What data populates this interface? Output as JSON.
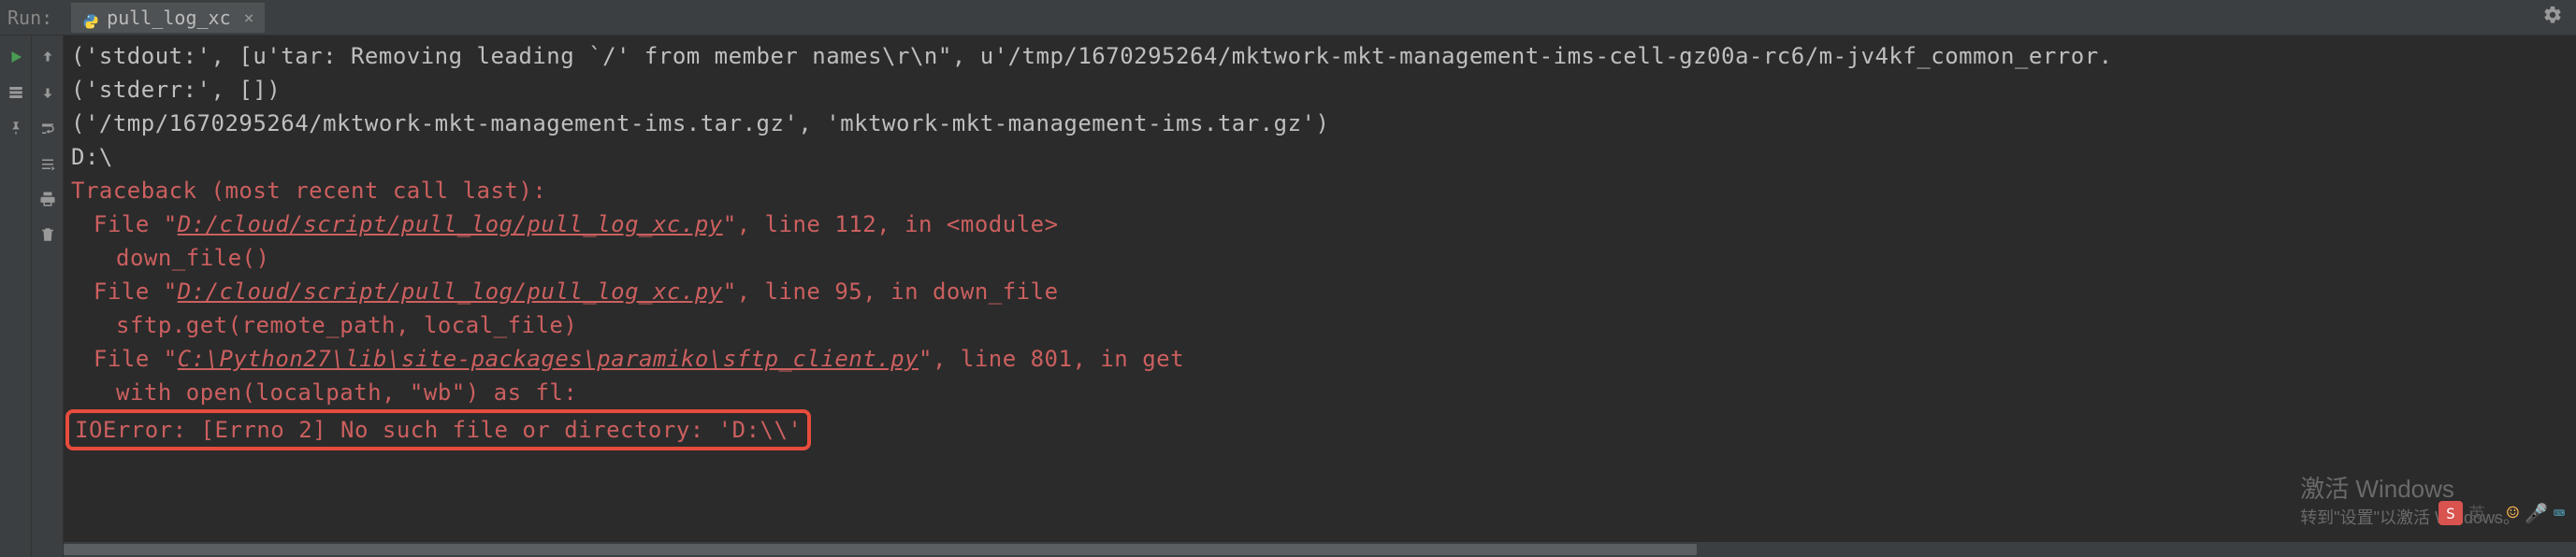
{
  "header": {
    "run_label": "Run:",
    "tab_label": "pull_log_xc",
    "tab_close": "×"
  },
  "console": {
    "line1": "('stdout:', [u'tar: Removing leading `/' from member names\\r\\n\", u'/tmp/1670295264/mktwork-mkt-management-ims-cell-gz00a-rc6/m-jv4kf_common_error.",
    "line2": "('stderr:', [])",
    "line3": "('/tmp/1670295264/mktwork-mkt-management-ims.tar.gz', 'mktwork-mkt-management-ims.tar.gz')",
    "line4": "D:\\",
    "traceback_header": "Traceback (most recent call last):",
    "tb1_prefix": "File \"",
    "tb1_path": "D:/cloud/script/pull_log/pull_log_xc.py",
    "tb1_suffix": "\", line 112, in <module>",
    "tb1_code": "down_file()",
    "tb2_prefix": "File \"",
    "tb2_path": "D:/cloud/script/pull_log/pull_log_xc.py",
    "tb2_suffix": "\", line 95, in down_file",
    "tb2_code": "sftp.get(remote_path, local_file)",
    "tb3_prefix": "File \"",
    "tb3_path": "C:\\Python27\\lib\\site-packages\\paramiko\\sftp_client.py",
    "tb3_suffix": "\", line 801, in get",
    "tb3_code": "with open(localpath, \"wb\") as fl:",
    "error_line": "IOError: [Errno 2] No such file or directory: 'D:\\\\'"
  },
  "watermark": {
    "line1": "激活 Windows",
    "line2": "转到\"设置\"以激活 Windows。"
  },
  "ime": {
    "text": "英"
  }
}
